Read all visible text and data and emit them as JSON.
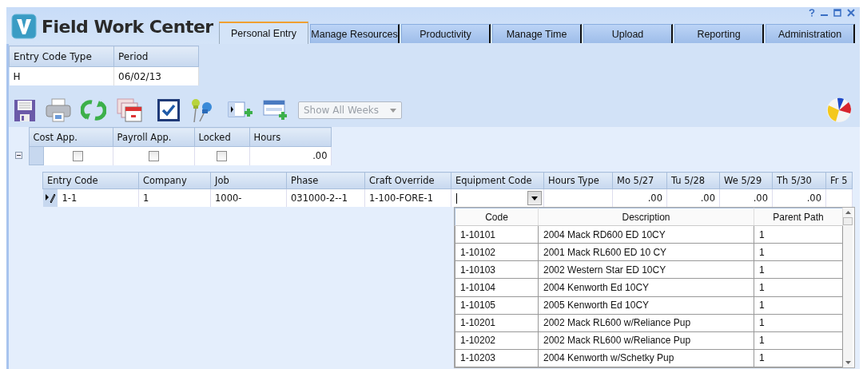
{
  "app": {
    "title": "Field Work Center"
  },
  "tabs": [
    {
      "label": "Personal Entry",
      "selected": true
    },
    {
      "label": "Manage Resources",
      "selected": false
    },
    {
      "label": "Productivity",
      "selected": false
    },
    {
      "label": "Manage Time",
      "selected": false
    },
    {
      "label": "Upload",
      "selected": false
    },
    {
      "label": "Reporting",
      "selected": false
    },
    {
      "label": "Administration",
      "selected": false
    }
  ],
  "header_table": {
    "columns": [
      "Entry Code Type",
      "Period"
    ],
    "row": [
      "H",
      "06/02/13"
    ]
  },
  "toolbar": {
    "week_filter": {
      "value": "Show All Weeks",
      "disabled": true
    }
  },
  "summary_grid": {
    "columns": [
      "Cost App.",
      "Payroll App.",
      "Locked",
      "Hours"
    ],
    "rows": [
      {
        "expanded": true,
        "cost_app": false,
        "payroll_app": false,
        "locked": false,
        "hours": ".00"
      }
    ]
  },
  "detail_grid": {
    "columns": [
      "Entry Code",
      "Company",
      "Job",
      "Phase",
      "Craft Override",
      "Equipment Code",
      "Hours Type",
      "Mo 5/27",
      "Tu 5/28",
      "We 5/29",
      "Th 5/30",
      "Fr 5"
    ],
    "rows": [
      {
        "editing": true,
        "entry_code": "1-1",
        "company": "1",
        "job": "1000-",
        "phase": "031000-2--1",
        "craft_override": "1-100-FORE-1",
        "day_hours": [
          ".00",
          ".00",
          ".00",
          ".00"
        ]
      }
    ]
  },
  "equipment_dropdown": {
    "open": true,
    "columns": [
      "Code",
      "Description",
      "Parent Path"
    ],
    "rows": [
      {
        "code": "1-10101",
        "description": "2004 Mack RD600 ED 10CY",
        "parent_path": "1"
      },
      {
        "code": "1-10102",
        "description": "2001 Mack RL600 ED 10 CY",
        "parent_path": "1"
      },
      {
        "code": "1-10103",
        "description": "2002 Western Star ED 10CY",
        "parent_path": "1"
      },
      {
        "code": "1-10104",
        "description": "2004 Kenworth Ed 10CY",
        "parent_path": "1"
      },
      {
        "code": "1-10105",
        "description": "2005 Kenworth Ed 10CY",
        "parent_path": "1"
      },
      {
        "code": "1-10201",
        "description": "2002 Mack RL600 w/Reliance Pup",
        "parent_path": "1"
      },
      {
        "code": "1-10202",
        "description": "2002 Mack RL600 w/Reliance Pup",
        "parent_path": "1"
      },
      {
        "code": "1-10203",
        "description": "2004 Kenworth w/Schetky Pup",
        "parent_path": "1"
      }
    ]
  }
}
